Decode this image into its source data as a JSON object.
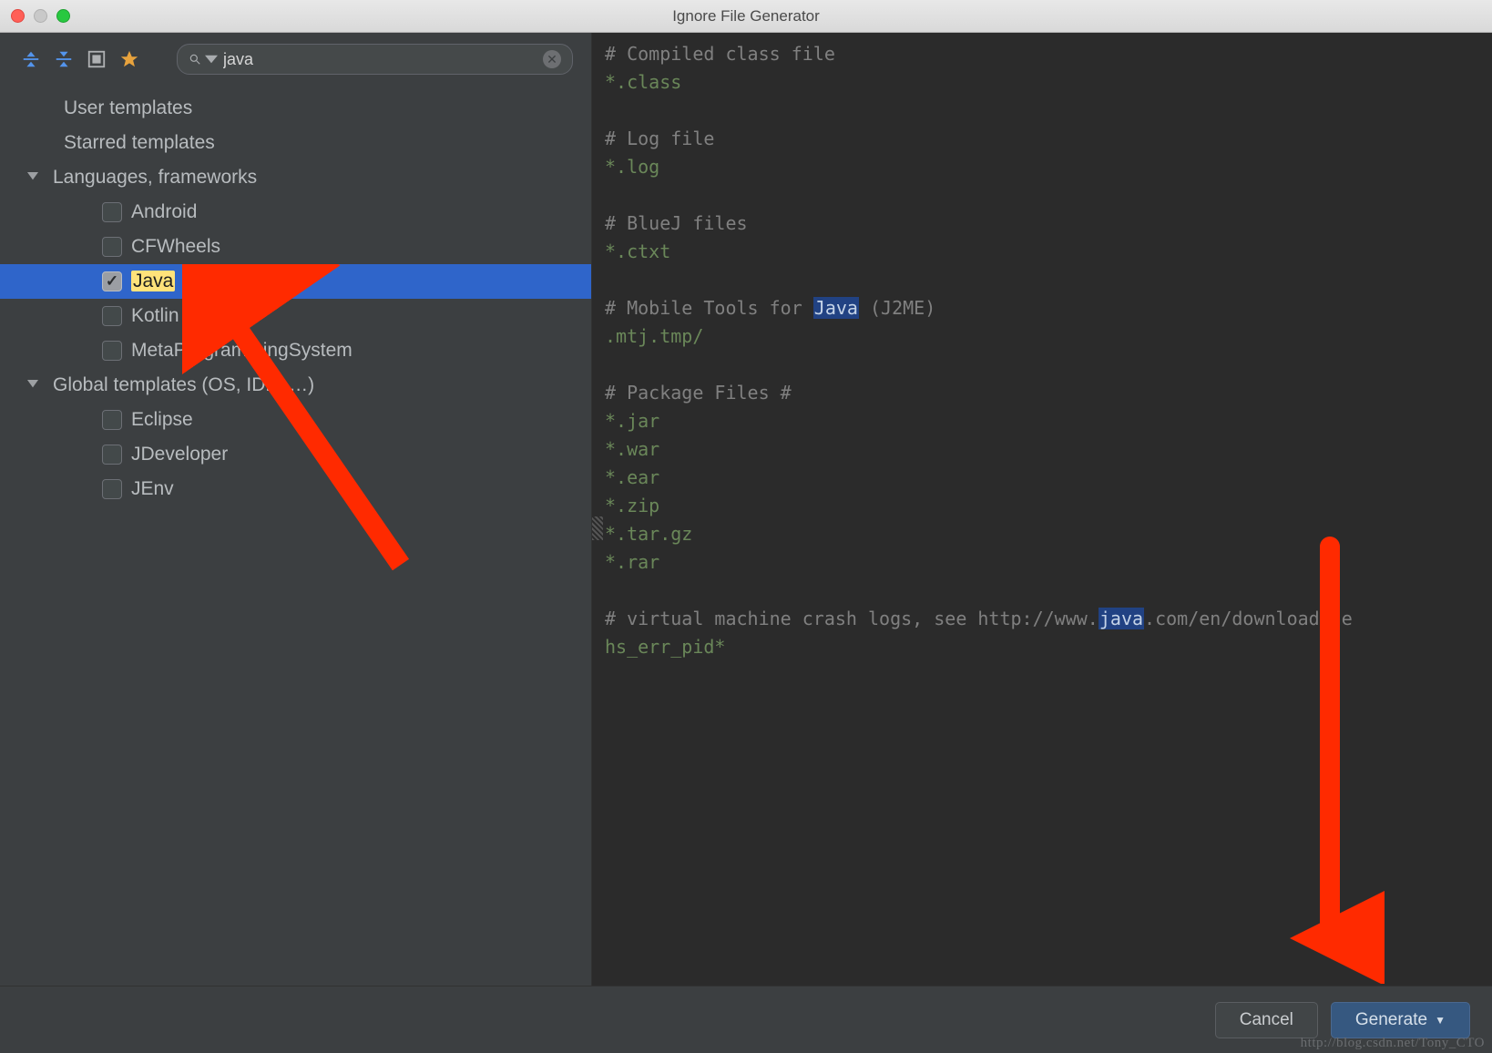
{
  "window": {
    "title": "Ignore File Generator"
  },
  "toolbar": {
    "search_value": "java",
    "search_prefix": "Q",
    "icons": {
      "collapse": "collapse-all-icon",
      "expand": "expand-all-icon",
      "select": "select-all-icon",
      "star": "star-icon"
    }
  },
  "tree": {
    "sections": [
      {
        "label": "User templates",
        "type": "header"
      },
      {
        "label": "Starred templates",
        "type": "header"
      },
      {
        "label": "Languages, frameworks",
        "type": "category",
        "expanded": true,
        "items": [
          {
            "label": "Android",
            "checked": false
          },
          {
            "label": "CFWheels",
            "checked": false
          },
          {
            "label": "Java",
            "checked": true,
            "selected": true,
            "highlight": "Java"
          },
          {
            "label": "Kotlin",
            "checked": false
          },
          {
            "label": "MetaProgrammingSystem",
            "checked": false
          }
        ]
      },
      {
        "label": "Global templates (OS, IDE, …)",
        "type": "category",
        "expanded": true,
        "items": [
          {
            "label": "Eclipse",
            "checked": false
          },
          {
            "label": "JDeveloper",
            "checked": false
          },
          {
            "label": "JEnv",
            "checked": false
          }
        ]
      }
    ]
  },
  "editor": {
    "lines": [
      {
        "t": "# Compiled class file",
        "c": "cmt"
      },
      {
        "t": "*.class",
        "c": "grn"
      },
      {
        "t": "",
        "c": ""
      },
      {
        "t": "# Log file",
        "c": "cmt"
      },
      {
        "t": "*.log",
        "c": "grn"
      },
      {
        "t": "",
        "c": ""
      },
      {
        "t": "# BlueJ files",
        "c": "cmt"
      },
      {
        "t": "*.ctxt",
        "c": "grn"
      },
      {
        "t": "",
        "c": ""
      },
      {
        "parts": [
          {
            "t": "# Mobile Tools for ",
            "c": "cmt"
          },
          {
            "t": "Java",
            "c": "hl"
          },
          {
            "t": " (J2ME)",
            "c": "cmt"
          }
        ]
      },
      {
        "t": ".mtj.tmp/",
        "c": "grn"
      },
      {
        "t": "",
        "c": ""
      },
      {
        "t": "# Package Files #",
        "c": "cmt"
      },
      {
        "t": "*.jar",
        "c": "grn"
      },
      {
        "t": "*.war",
        "c": "grn"
      },
      {
        "t": "*.ear",
        "c": "grn"
      },
      {
        "t": "*.zip",
        "c": "grn"
      },
      {
        "t": "*.tar.gz",
        "c": "grn"
      },
      {
        "t": "*.rar",
        "c": "grn"
      },
      {
        "t": "",
        "c": ""
      },
      {
        "parts": [
          {
            "t": "# virtual machine crash logs, see http://www.",
            "c": "cmt"
          },
          {
            "t": "java",
            "c": "hl"
          },
          {
            "t": ".com/en/download/he",
            "c": "cmt"
          }
        ]
      },
      {
        "t": "hs_err_pid*",
        "c": "grn"
      }
    ]
  },
  "footer": {
    "cancel": "Cancel",
    "generate": "Generate"
  },
  "watermark": "http://blog.csdn.net/Tony_CTO"
}
